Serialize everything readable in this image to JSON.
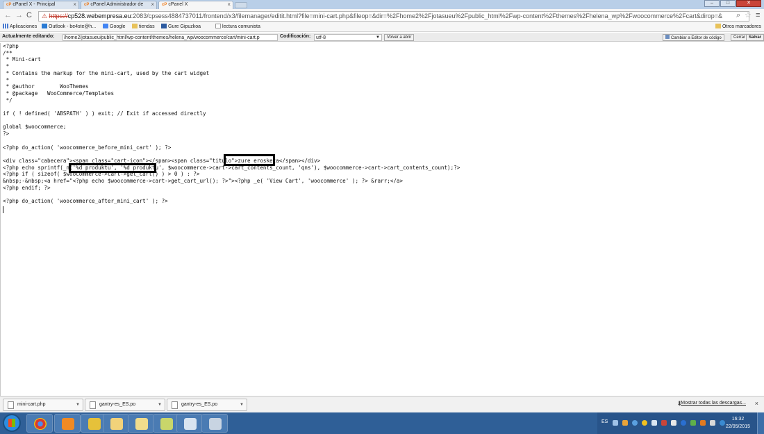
{
  "browser": {
    "tabs": [
      {
        "label": "cPanel X - Principal",
        "favicon": "cpanel-icon"
      },
      {
        "label": "cPanel Administrador de",
        "favicon": "cpanel-icon"
      },
      {
        "label": "cPanel X",
        "favicon": "cpanel-icon"
      }
    ],
    "tab_favicon_text": "cP",
    "url": {
      "scheme": "https://",
      "host": "cp528.webempresa.eu",
      "rest": ":2083/cpsess4884737011/frontend/x3/filemanager/editit.html?file=mini-cart.php&fileop=&dir=%2Fhome2%2Fjotasueu%2Fpublic_html%2Fwp-content%2Fthemes%2Fhelena_wp%2Fwoocommerce%2Fcart&dirop=&"
    },
    "bookmarks": [
      {
        "label": "Aplicaciones",
        "icon": "apps-grid-icon"
      },
      {
        "label": "Outlook - be4ste@h...",
        "icon": "outlook-icon"
      },
      {
        "label": "Google",
        "icon": "google-icon"
      },
      {
        "label": "tiendas",
        "icon": "folder-icon"
      },
      {
        "label": "Gure Gipuzkoa",
        "icon": "gipuzkoa-icon"
      },
      {
        "label": "lectura comunista",
        "icon": "page-icon"
      }
    ],
    "other_bookmarks": "Otros marcadores"
  },
  "editor": {
    "editing_label": "Actualmente editando:",
    "path": "/home2/jotasueu/public_html/wp-content/themes/helena_wp/woocommerce/cart/mini-cart.p",
    "encoding_label": "Codificación:",
    "encoding_value": "utf-8",
    "reopen_button": "Volver a abrir",
    "switch_editor_button": "Cambiar a Editor de código",
    "close_button": "Cerrar",
    "save_button": "Salvar",
    "code_lines": [
      "<?php",
      "/**",
      " * Mini-cart",
      " *",
      " * Contains the markup for the mini-cart, used by the cart widget",
      " *",
      " * @author        WooThemes",
      " * @package   WooCommerce/Templates",
      " */",
      "",
      "if ( ! defined( 'ABSPATH' ) ) exit; // Exit if accessed directly",
      "",
      "global $woocommerce;",
      "?>",
      "",
      "<?php do_action( 'woocommerce_before_mini_cart' ); ?>",
      "",
      "<div class=\"cabecera\"><span class=\"cart-icon\"></span><span class=\"titulo\">zure erosketa</span></div>",
      "<?php echo sprintf(_n('%d produktu', '%d produktu', $woocommerce->cart->cart_contents_count, 'qns'), $woocommerce->cart->cart_contents_count);?>",
      "<?php if ( sizeof( $woocommerce->cart->get_cart() ) > 0 ) : ?>",
      "&nbsp;-&nbsp;<a href=\"<?php echo $woocommerce->cart->get_cart_url(); ?>\"><?php _e( 'View Cart', 'woocommerce' ); ?> &rarr;</a>",
      "<?php endif; ?>",
      "",
      "<?php do_action( 'woocommerce_after_mini_cart' ); ?>"
    ]
  },
  "downloads": {
    "items": [
      {
        "name": "mini-cart.php"
      },
      {
        "name": "gantry-es_ES.po"
      },
      {
        "name": "gantry-es_ES.po"
      }
    ],
    "show_all": "Mostrar todas las descargas...",
    "close": "×"
  },
  "taskbar": {
    "apps": [
      "chrome-icon",
      "media-player-icon",
      "paint-bucket-icon",
      "file-explorer-icon",
      "folder-icon",
      "network-icon",
      "paint-icon",
      "calculator-icon"
    ],
    "language": "ES",
    "time": "16:32",
    "date": "22/05/2015"
  }
}
